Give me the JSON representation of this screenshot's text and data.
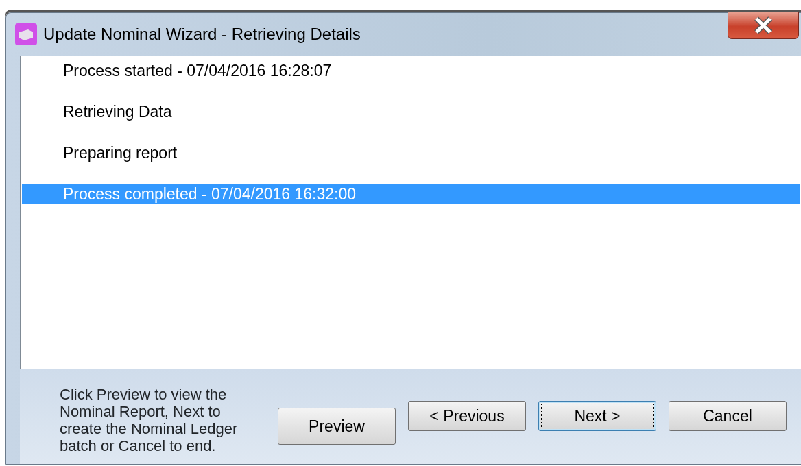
{
  "window": {
    "title": "Update Nominal Wizard - Retrieving Details"
  },
  "log": [
    {
      "text": "Process started - 07/04/2016 16:28:07",
      "selected": false
    },
    {
      "text": "Retrieving Data",
      "selected": false
    },
    {
      "text": "Preparing report",
      "selected": false
    },
    {
      "text": "Process completed - 07/04/2016 16:32:00",
      "selected": true
    }
  ],
  "instructions": "Click Preview to view the Nominal Report, Next to create the Nominal Ledger batch or Cancel to end.",
  "buttons": [
    {
      "label": "Preview",
      "focused": false
    },
    {
      "label": "< Previous",
      "focused": false
    },
    {
      "label": "Next >",
      "focused": true
    },
    {
      "label": "Cancel",
      "focused": false
    }
  ]
}
